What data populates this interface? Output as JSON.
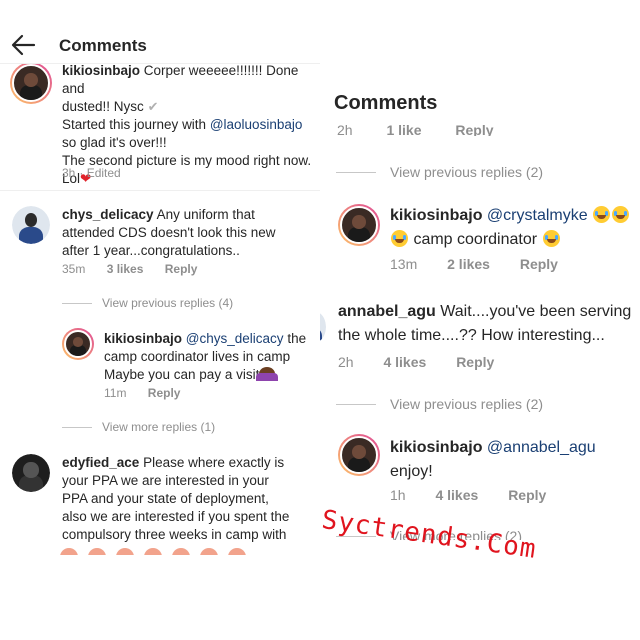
{
  "left": {
    "header": {
      "title": "Comments"
    },
    "caption": {
      "username": "kikiosinbajo",
      "line1": "Corper weeeee!!!!!!! Done and",
      "line1b": "dusted!! Nysc",
      "line2a": "Started this journey with ",
      "line2_mention": "@laoluosinbajo",
      "line3": "so glad it's over!!!",
      "line4": "The second picture is my mood right now.",
      "line5": "Lol",
      "meta_time": "3h",
      "meta_edited": "· Edited"
    },
    "comment1": {
      "username": "chys_delicacy",
      "line1": "Any uniform that",
      "line2": "attended CDS doesn't look this new",
      "line3": "after 1 year...congratulations..",
      "time": "35m",
      "likes": "3 likes",
      "reply": "Reply"
    },
    "view_previous": "View previous replies (4)",
    "reply1": {
      "username": "kikiosinbajo",
      "mention": "@chys_delicacy",
      "line1_tail": "the",
      "line2": "camp coordinator lives in camp",
      "line3": "Maybe you can pay a visit",
      "time": "11m",
      "reply": "Reply"
    },
    "view_more": "View more replies (1)",
    "comment2": {
      "username": "edyfied_ace",
      "line1": "Please where exactly is",
      "line2": "your PPA we are interested in your",
      "line3": "PPA and your state of deployment,",
      "line4": "also we are interested if you spent the",
      "line5": "compulsory three weeks in camp with"
    }
  },
  "right": {
    "cut_header": "Comments",
    "cut_meta_time": "2h",
    "cut_meta_likes": "1 like",
    "cut_meta_reply": "Reply",
    "view_previous_1": "View previous replies (2)",
    "reply1": {
      "username": "kikiosinbajo",
      "mention": "@crystalmyke",
      "line2": "camp coordinator",
      "time": "13m",
      "likes": "2 likes",
      "reply": "Reply"
    },
    "comment1": {
      "username": "annabel_agu",
      "line1": "Wait....you've been serving",
      "line2": "the whole time....?? How interesting...",
      "time": "2h",
      "likes": "4 likes",
      "reply": "Reply"
    },
    "view_previous_2": "View previous replies (2)",
    "reply2": {
      "username": "kikiosinbajo",
      "mention": "@annabel_agu",
      "line2": "enjoy!",
      "time": "1h",
      "likes": "4 likes",
      "reply": "Reply"
    },
    "view_more_cut": "View more replies (2)"
  },
  "watermark": "Syctrends.Com",
  "colors": {
    "mention": "#1a3f73",
    "meta": "#8e8e8e",
    "watermark": "#e0141e",
    "story_ring_start": "#fdc468",
    "story_ring_end": "#df4996"
  },
  "icons": [
    "back-arrow-icon",
    "check-mark-icon",
    "heart-emoji-icon",
    "laughing-emoji-icon",
    "facepalm-emoji-icon"
  ]
}
